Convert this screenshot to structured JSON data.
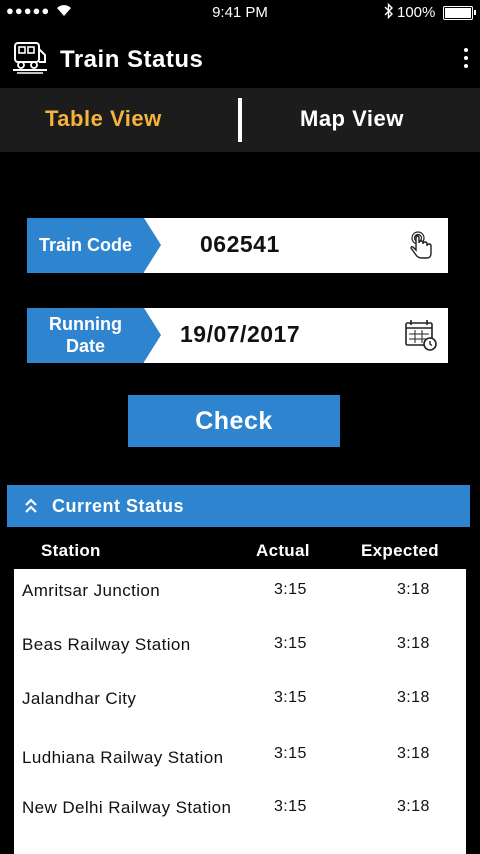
{
  "status_bar": {
    "signal": "●●●●●",
    "time": "9:41 PM",
    "battery": "100%"
  },
  "app_bar": {
    "title": "Train Status"
  },
  "tabs": [
    {
      "label": "Table View",
      "active": true
    },
    {
      "label": "Map View",
      "active": false
    }
  ],
  "form": {
    "train_code_label": "Train Code",
    "train_code_value": "062541",
    "running_date_label_line1": "Running",
    "running_date_label_line2": "Date",
    "running_date_value": "19/07/2017",
    "check_label": "Check"
  },
  "current_status": {
    "label": "Current Status",
    "columns": [
      "Station",
      "Actual",
      "Expected"
    ],
    "rows": [
      {
        "station": "Amritsar Junction",
        "actual": "3:15",
        "expected": "3:18"
      },
      {
        "station": "Beas Railway Station",
        "actual": "3:15",
        "expected": "3:18"
      },
      {
        "station": "Jalandhar City",
        "actual": "3:15",
        "expected": "3:18"
      },
      {
        "station": "Ludhiana Railway Station",
        "actual": "3:15",
        "expected": "3:18"
      },
      {
        "station": "New Delhi Railway Station",
        "actual": "3:15",
        "expected": "3:18"
      }
    ]
  },
  "colors": {
    "accent_blue": "#2e84cf",
    "active_tab": "#f3b33d",
    "tab_bar_bg": "#1c1c1c",
    "background": "#000000"
  }
}
